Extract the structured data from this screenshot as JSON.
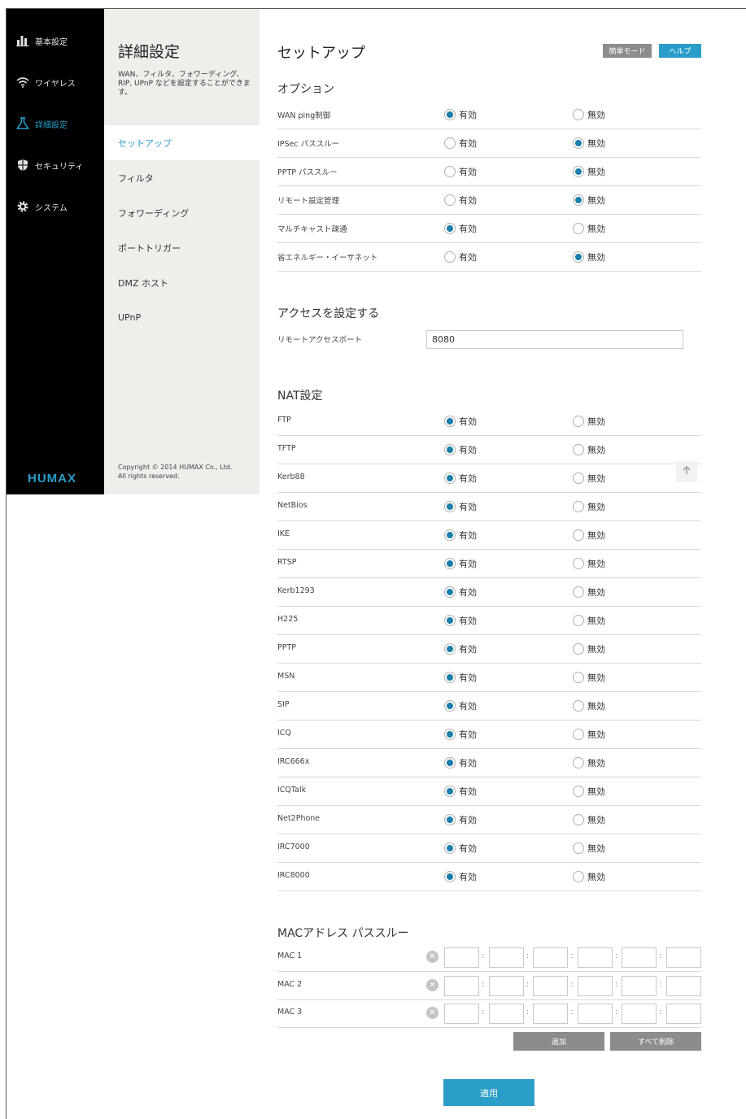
{
  "nav": {
    "items": [
      {
        "label": "基本設定",
        "icon": "bar-chart-icon"
      },
      {
        "label": "ワイヤレス",
        "icon": "wifi-icon"
      },
      {
        "label": "詳細設定",
        "icon": "flask-icon",
        "active": true
      },
      {
        "label": "セキュリティ",
        "icon": "shield-icon"
      },
      {
        "label": "システム",
        "icon": "gear-icon"
      }
    ],
    "logo": "HUMAX"
  },
  "subnav": {
    "title": "詳細設定",
    "description": "WAN、フィルタ、フォワーディング、RIP, UPnP などを設定することができます。",
    "items": [
      "セットアップ",
      "フィルタ",
      "フォワーディング",
      "ポートトリガー",
      "DMZ ホスト",
      "UPnP"
    ],
    "active_index": 0,
    "copyright_line1": "Copyright © 2014 HUMAX Co., Ltd.",
    "copyright_line2": "All rights reserved."
  },
  "main": {
    "title": "セットアップ",
    "simple_mode": "簡単モード",
    "help": "ヘルプ",
    "enable_label": "有効",
    "disable_label": "無効",
    "options_title": "オプション",
    "options": [
      {
        "label": "WAN ping制御",
        "enabled": true
      },
      {
        "label": "IPSec パススルー",
        "enabled": false
      },
      {
        "label": "PPTP パススルー",
        "enabled": false
      },
      {
        "label": "リモート設定管理",
        "enabled": false
      },
      {
        "label": "マルチキャスト疎通",
        "enabled": true
      },
      {
        "label": "省エネルギー・イーサネット",
        "enabled": false
      }
    ],
    "access_title": "アクセスを設定する",
    "remote_port_label": "リモートアクセスポート",
    "remote_port_value": "8080",
    "nat_title": "NAT設定",
    "nat": [
      {
        "label": "FTP",
        "enabled": true
      },
      {
        "label": "TFTP",
        "enabled": true
      },
      {
        "label": "Kerb88",
        "enabled": true
      },
      {
        "label": "NetBios",
        "enabled": true
      },
      {
        "label": "IKE",
        "enabled": true
      },
      {
        "label": "RTSP",
        "enabled": true
      },
      {
        "label": "Kerb1293",
        "enabled": true
      },
      {
        "label": "H225",
        "enabled": true
      },
      {
        "label": "PPTP",
        "enabled": true
      },
      {
        "label": "MSN",
        "enabled": true
      },
      {
        "label": "SIP",
        "enabled": true
      },
      {
        "label": "ICQ",
        "enabled": true
      },
      {
        "label": "IRC666x",
        "enabled": true
      },
      {
        "label": "ICQTalk",
        "enabled": true
      },
      {
        "label": "Net2Phone",
        "enabled": true
      },
      {
        "label": "IRC7000",
        "enabled": true
      },
      {
        "label": "IRC8000",
        "enabled": true
      }
    ],
    "mac_title": "MACアドレス パススルー",
    "mac_rows": [
      "MAC 1",
      "MAC 2",
      "MAC 3"
    ],
    "mac_separator": ":",
    "add": "追加",
    "delete_all": "すべて削除",
    "apply": "適用"
  },
  "colors": {
    "accent": "#2a9dc9",
    "nav_bg": "#000000",
    "subnav_bg": "#f0eeeb",
    "gray_button": "#8c8c8c"
  }
}
